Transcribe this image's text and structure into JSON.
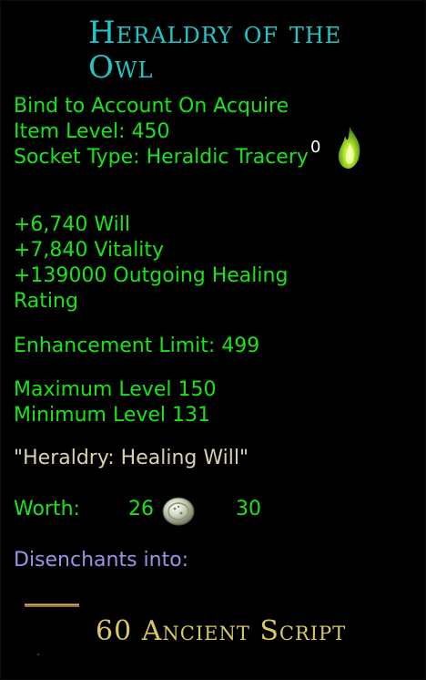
{
  "item": {
    "name": "Heraldry of the Owl",
    "binding": "Bind to Account On Acquire",
    "item_level": "Item Level: 450",
    "socket_type": "Socket Type: Heraldic Tracery",
    "socket_count": "0",
    "stats": [
      "+6,740 Will",
      "+7,840 Vitality",
      "+139000 Outgoing Healing",
      "Rating"
    ],
    "enhancement_limit": "Enhancement Limit: 499",
    "max_level": "Maximum Level 150",
    "min_level": "Minimum Level 131",
    "description": "\"Heraldry: Healing Will\"",
    "worth_label": "Worth:",
    "worth_silver": "26",
    "worth_copper": "30",
    "disenchant_label": "Disenchants into:",
    "disenchant_reward": "60 Ancient Script"
  },
  "icons": {
    "socket": "green-flame-icon",
    "currency": "silver-coin-icon",
    "reward": "ancient-script-icon"
  },
  "colors": {
    "title": "#1fc7c7",
    "stat_text": "#18e418",
    "quote": "#d8d2b0",
    "disenchant": "#9c92e8",
    "reward_text": "#d8c860",
    "background": "#000000"
  }
}
